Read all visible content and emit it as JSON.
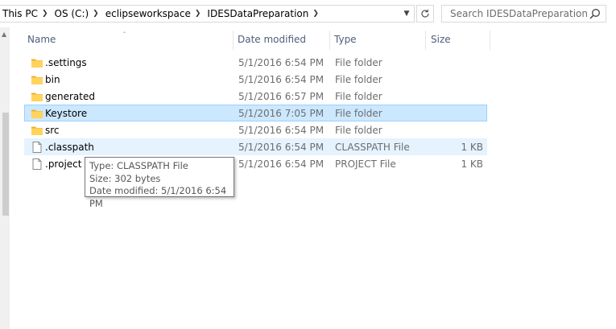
{
  "address": {
    "breadcrumbs": [
      "This PC",
      "OS (C:)",
      "eclipseworkspace",
      "IDESDataPreparation"
    ]
  },
  "search": {
    "placeholder": "Search IDESDataPreparation"
  },
  "columns": {
    "name": "Name",
    "date": "Date modified",
    "type": "Type",
    "size": "Size"
  },
  "files": [
    {
      "name": ".settings",
      "date": "5/1/2016 6:54 PM",
      "type": "File folder",
      "size": "",
      "icon": "folder-icon"
    },
    {
      "name": "bin",
      "date": "5/1/2016 6:54 PM",
      "type": "File folder",
      "size": "",
      "icon": "folder-icon"
    },
    {
      "name": "generated",
      "date": "5/1/2016 6:57 PM",
      "type": "File folder",
      "size": "",
      "icon": "folder-icon"
    },
    {
      "name": "Keystore",
      "date": "5/1/2016 7:05 PM",
      "type": "File folder",
      "size": "",
      "icon": "folder-icon",
      "state": "selected"
    },
    {
      "name": "src",
      "date": "5/1/2016 6:54 PM",
      "type": "File folder",
      "size": "",
      "icon": "folder-icon"
    },
    {
      "name": ".classpath",
      "date": "5/1/2016 6:54 PM",
      "type": "CLASSPATH File",
      "size": "1 KB",
      "icon": "file-icon",
      "state": "hover"
    },
    {
      "name": ".project",
      "date": "5/1/2016 6:54 PM",
      "type": "PROJECT File",
      "size": "1 KB",
      "icon": "file-icon"
    }
  ],
  "tooltip": {
    "type_line": "Type: CLASSPATH File",
    "size_line": "Size: 302 bytes",
    "date_line": "Date modified: 5/1/2016 6:54 PM"
  },
  "colors": {
    "selected_bg": "#cce8ff",
    "selected_border": "#99d1ff",
    "hover_bg": "#e5f3ff",
    "header_text": "#4c607a",
    "folder_yellow": "#ffd35c"
  }
}
